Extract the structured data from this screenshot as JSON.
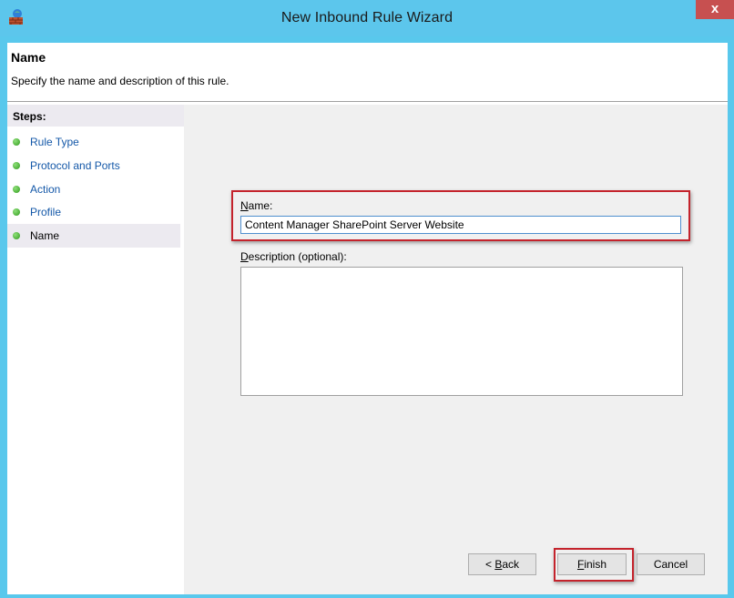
{
  "window": {
    "title": "New Inbound Rule Wizard",
    "close_glyph": "x",
    "icon": "firewall-wall-icon"
  },
  "header": {
    "heading": "Name",
    "subheading": "Specify the name and description of this rule."
  },
  "steps": {
    "title": "Steps:",
    "items": [
      {
        "label": "Rule Type",
        "current": false
      },
      {
        "label": "Protocol and Ports",
        "current": false
      },
      {
        "label": "Action",
        "current": false
      },
      {
        "label": "Profile",
        "current": false
      },
      {
        "label": "Name",
        "current": true
      }
    ]
  },
  "form": {
    "name_label_accel": "N",
    "name_label_rest": "ame:",
    "name_value": "Content Manager SharePoint Server Website",
    "desc_label_accel": "D",
    "desc_label_rest": "escription (optional):",
    "desc_value": ""
  },
  "buttons": {
    "back_prefix": "< ",
    "back_accel": "B",
    "back_rest": "ack",
    "finish_accel": "F",
    "finish_rest": "inish",
    "cancel": "Cancel"
  },
  "colors": {
    "titlebar": "#5cc6ec",
    "highlight": "#c4232c",
    "step_link": "#1458a8"
  }
}
